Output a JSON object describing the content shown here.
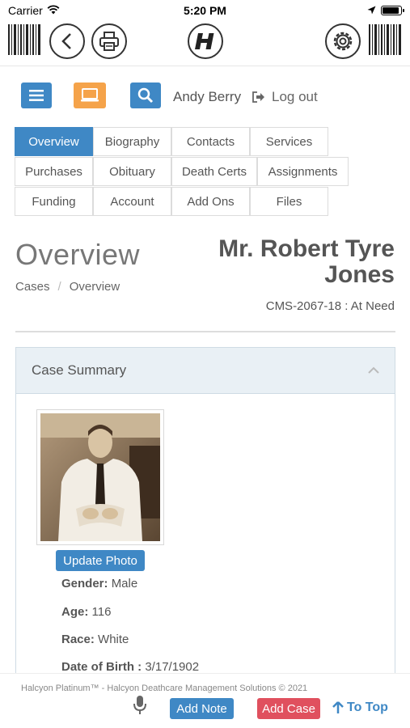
{
  "status_bar": {
    "carrier": "Carrier",
    "time": "5:20 PM",
    "battery_level": 0.9
  },
  "toolbar": {
    "icons": [
      "barcode-icon",
      "back-icon",
      "print-icon",
      "halcyon-logo-icon",
      "settings-icon",
      "barcode-icon"
    ]
  },
  "header": {
    "user_name": "Andy Berry",
    "logout_label": "Log out",
    "colors": {
      "menu": "#3f88c5",
      "computer": "#f5a34a",
      "search": "#3f88c5"
    }
  },
  "tabs": [
    {
      "label": "Overview",
      "active": true
    },
    {
      "label": "Biography"
    },
    {
      "label": "Contacts"
    },
    {
      "label": "Services"
    },
    {
      "label": "Purchases"
    },
    {
      "label": "Obituary"
    },
    {
      "label": "Death Certs"
    },
    {
      "label": "Assignments"
    },
    {
      "label": "Funding"
    },
    {
      "label": "Account"
    },
    {
      "label": "Add Ons"
    },
    {
      "label": "Files"
    }
  ],
  "page": {
    "title": "Overview",
    "breadcrumb": [
      "Cases",
      "Overview"
    ],
    "person_name": "Mr. Robert Tyre Jones",
    "case_ref": "CMS-2067-18 : At Need"
  },
  "case_summary": {
    "title": "Case Summary",
    "update_photo_label": "Update Photo",
    "facts": [
      {
        "label": "Gender:",
        "value": "Male"
      },
      {
        "label": "Age:",
        "value": "116"
      },
      {
        "label": "Race:",
        "value": "White"
      },
      {
        "label": "Date of Birth :",
        "value": "3/17/1902"
      }
    ]
  },
  "footer": {
    "copyright": "Halcyon Platinum™ - Halcyon Deathcare Management Solutions © 2021",
    "add_note_label": "Add Note",
    "add_case_label": "Add Case",
    "to_top_label": "To Top",
    "colors": {
      "add_note": "#3f88c5",
      "add_case": "#e0505e"
    }
  }
}
